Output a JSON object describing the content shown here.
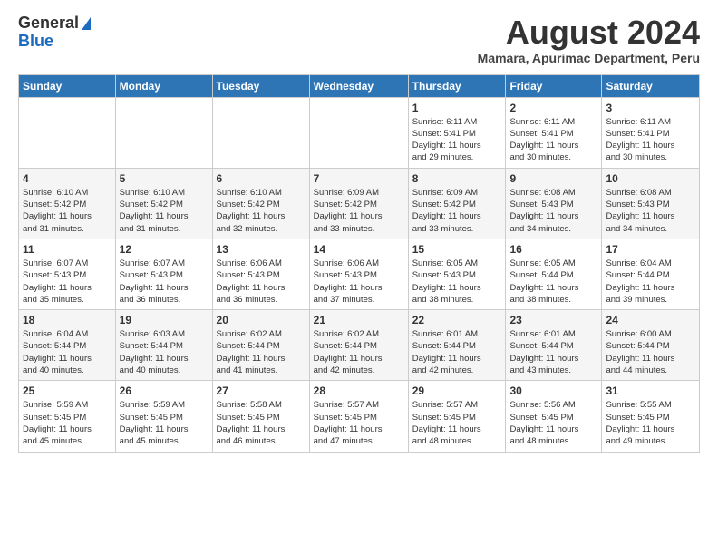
{
  "logo": {
    "general": "General",
    "blue": "Blue"
  },
  "title": {
    "month_year": "August 2024",
    "location": "Mamara, Apurimac Department, Peru"
  },
  "headers": [
    "Sunday",
    "Monday",
    "Tuesday",
    "Wednesday",
    "Thursday",
    "Friday",
    "Saturday"
  ],
  "weeks": [
    [
      {
        "day": "",
        "info": ""
      },
      {
        "day": "",
        "info": ""
      },
      {
        "day": "",
        "info": ""
      },
      {
        "day": "",
        "info": ""
      },
      {
        "day": "1",
        "info": "Sunrise: 6:11 AM\nSunset: 5:41 PM\nDaylight: 11 hours\nand 29 minutes."
      },
      {
        "day": "2",
        "info": "Sunrise: 6:11 AM\nSunset: 5:41 PM\nDaylight: 11 hours\nand 30 minutes."
      },
      {
        "day": "3",
        "info": "Sunrise: 6:11 AM\nSunset: 5:41 PM\nDaylight: 11 hours\nand 30 minutes."
      }
    ],
    [
      {
        "day": "4",
        "info": "Sunrise: 6:10 AM\nSunset: 5:42 PM\nDaylight: 11 hours\nand 31 minutes."
      },
      {
        "day": "5",
        "info": "Sunrise: 6:10 AM\nSunset: 5:42 PM\nDaylight: 11 hours\nand 31 minutes."
      },
      {
        "day": "6",
        "info": "Sunrise: 6:10 AM\nSunset: 5:42 PM\nDaylight: 11 hours\nand 32 minutes."
      },
      {
        "day": "7",
        "info": "Sunrise: 6:09 AM\nSunset: 5:42 PM\nDaylight: 11 hours\nand 33 minutes."
      },
      {
        "day": "8",
        "info": "Sunrise: 6:09 AM\nSunset: 5:42 PM\nDaylight: 11 hours\nand 33 minutes."
      },
      {
        "day": "9",
        "info": "Sunrise: 6:08 AM\nSunset: 5:43 PM\nDaylight: 11 hours\nand 34 minutes."
      },
      {
        "day": "10",
        "info": "Sunrise: 6:08 AM\nSunset: 5:43 PM\nDaylight: 11 hours\nand 34 minutes."
      }
    ],
    [
      {
        "day": "11",
        "info": "Sunrise: 6:07 AM\nSunset: 5:43 PM\nDaylight: 11 hours\nand 35 minutes."
      },
      {
        "day": "12",
        "info": "Sunrise: 6:07 AM\nSunset: 5:43 PM\nDaylight: 11 hours\nand 36 minutes."
      },
      {
        "day": "13",
        "info": "Sunrise: 6:06 AM\nSunset: 5:43 PM\nDaylight: 11 hours\nand 36 minutes."
      },
      {
        "day": "14",
        "info": "Sunrise: 6:06 AM\nSunset: 5:43 PM\nDaylight: 11 hours\nand 37 minutes."
      },
      {
        "day": "15",
        "info": "Sunrise: 6:05 AM\nSunset: 5:43 PM\nDaylight: 11 hours\nand 38 minutes."
      },
      {
        "day": "16",
        "info": "Sunrise: 6:05 AM\nSunset: 5:44 PM\nDaylight: 11 hours\nand 38 minutes."
      },
      {
        "day": "17",
        "info": "Sunrise: 6:04 AM\nSunset: 5:44 PM\nDaylight: 11 hours\nand 39 minutes."
      }
    ],
    [
      {
        "day": "18",
        "info": "Sunrise: 6:04 AM\nSunset: 5:44 PM\nDaylight: 11 hours\nand 40 minutes."
      },
      {
        "day": "19",
        "info": "Sunrise: 6:03 AM\nSunset: 5:44 PM\nDaylight: 11 hours\nand 40 minutes."
      },
      {
        "day": "20",
        "info": "Sunrise: 6:02 AM\nSunset: 5:44 PM\nDaylight: 11 hours\nand 41 minutes."
      },
      {
        "day": "21",
        "info": "Sunrise: 6:02 AM\nSunset: 5:44 PM\nDaylight: 11 hours\nand 42 minutes."
      },
      {
        "day": "22",
        "info": "Sunrise: 6:01 AM\nSunset: 5:44 PM\nDaylight: 11 hours\nand 42 minutes."
      },
      {
        "day": "23",
        "info": "Sunrise: 6:01 AM\nSunset: 5:44 PM\nDaylight: 11 hours\nand 43 minutes."
      },
      {
        "day": "24",
        "info": "Sunrise: 6:00 AM\nSunset: 5:44 PM\nDaylight: 11 hours\nand 44 minutes."
      }
    ],
    [
      {
        "day": "25",
        "info": "Sunrise: 5:59 AM\nSunset: 5:45 PM\nDaylight: 11 hours\nand 45 minutes."
      },
      {
        "day": "26",
        "info": "Sunrise: 5:59 AM\nSunset: 5:45 PM\nDaylight: 11 hours\nand 45 minutes."
      },
      {
        "day": "27",
        "info": "Sunrise: 5:58 AM\nSunset: 5:45 PM\nDaylight: 11 hours\nand 46 minutes."
      },
      {
        "day": "28",
        "info": "Sunrise: 5:57 AM\nSunset: 5:45 PM\nDaylight: 11 hours\nand 47 minutes."
      },
      {
        "day": "29",
        "info": "Sunrise: 5:57 AM\nSunset: 5:45 PM\nDaylight: 11 hours\nand 48 minutes."
      },
      {
        "day": "30",
        "info": "Sunrise: 5:56 AM\nSunset: 5:45 PM\nDaylight: 11 hours\nand 48 minutes."
      },
      {
        "day": "31",
        "info": "Sunrise: 5:55 AM\nSunset: 5:45 PM\nDaylight: 11 hours\nand 49 minutes."
      }
    ]
  ]
}
